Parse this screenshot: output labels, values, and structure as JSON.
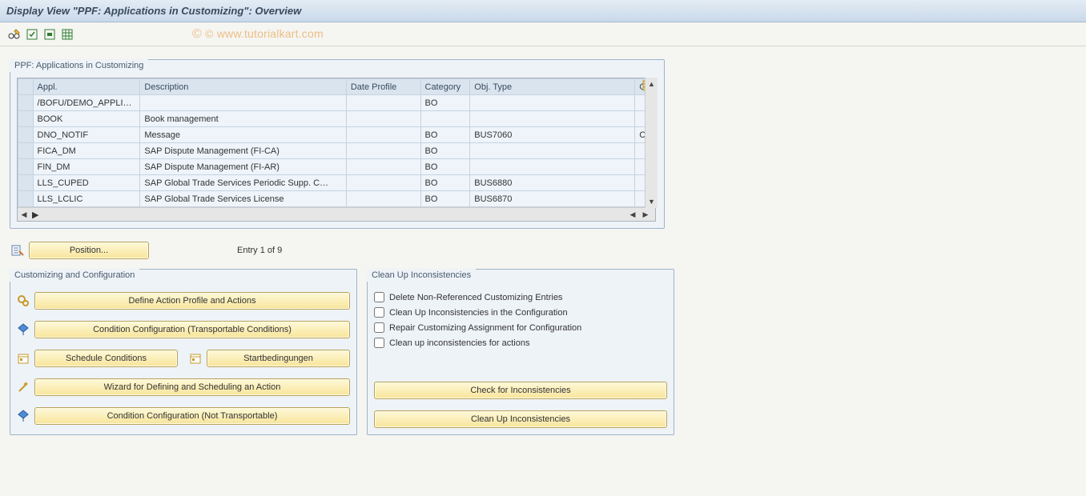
{
  "title": "Display View \"PPF: Applications in Customizing\": Overview",
  "watermark": "© www.tutorialkart.com",
  "table": {
    "legend": "PPF: Applications in Customizing",
    "columns": {
      "appl": "Appl.",
      "description": "Description",
      "date_profile": "Date Profile",
      "category": "Category",
      "obj_type": "Obj. Type",
      "co": "Co"
    },
    "rows": [
      {
        "appl": "/BOFU/DEMO_APPLI…",
        "description": "",
        "date_profile": "",
        "category": "BO",
        "obj_type": "",
        "co": ""
      },
      {
        "appl": "BOOK",
        "description": "Book management",
        "date_profile": "",
        "category": "",
        "obj_type": "",
        "co": ""
      },
      {
        "appl": "DNO_NOTIF",
        "description": "Message",
        "date_profile": "",
        "category": "BO",
        "obj_type": "BUS7060",
        "co": "CL"
      },
      {
        "appl": "FICA_DM",
        "description": "SAP Dispute Management (FI-CA)",
        "date_profile": "",
        "category": "BO",
        "obj_type": "",
        "co": ""
      },
      {
        "appl": "FIN_DM",
        "description": "SAP Dispute Management (FI-AR)",
        "date_profile": "",
        "category": "BO",
        "obj_type": "",
        "co": ""
      },
      {
        "appl": "LLS_CUPED",
        "description": "SAP Global Trade Services Periodic Supp. C…",
        "date_profile": "",
        "category": "BO",
        "obj_type": "BUS6880",
        "co": ""
      },
      {
        "appl": "LLS_LCLIC",
        "description": "SAP Global Trade Services License",
        "date_profile": "",
        "category": "BO",
        "obj_type": "BUS6870",
        "co": ""
      }
    ]
  },
  "position": {
    "button": "Position...",
    "entry_text": "Entry 1 of 9"
  },
  "left_panel": {
    "legend": "Customizing and Configuration",
    "buttons": {
      "define_action": "Define Action Profile and Actions",
      "cond_transportable": "Condition Configuration (Transportable Conditions)",
      "schedule_conditions": "Schedule Conditions",
      "startbedingungen": "Startbedingungen",
      "wizard": "Wizard for Defining and Scheduling an Action",
      "cond_not_transportable": "Condition Configuration (Not Transportable)"
    }
  },
  "right_panel": {
    "legend": "Clean Up Inconsistencies",
    "checks": {
      "delete_nonref": "Delete Non-Referenced Customizing Entries",
      "clean_config": "Clean Up Inconsistencies in the Configuration",
      "repair_assign": "Repair Customizing Assignment for Configuration",
      "clean_actions": "Clean up inconsistencies for actions"
    },
    "buttons": {
      "check": "Check for Inconsistencies",
      "clean": "Clean Up Inconsistencies"
    }
  }
}
